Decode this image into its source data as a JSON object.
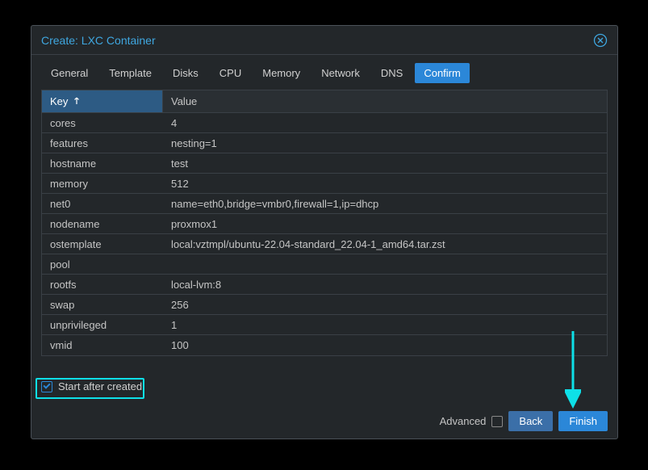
{
  "title": "Create: LXC Container",
  "tabs": {
    "general": "General",
    "template": "Template",
    "disks": "Disks",
    "cpu": "CPU",
    "memory": "Memory",
    "network": "Network",
    "dns": "DNS",
    "confirm": "Confirm"
  },
  "grid": {
    "key_header": "Key",
    "value_header": "Value"
  },
  "rows": [
    {
      "key": "cores",
      "value": "4"
    },
    {
      "key": "features",
      "value": "nesting=1"
    },
    {
      "key": "hostname",
      "value": "test"
    },
    {
      "key": "memory",
      "value": "512"
    },
    {
      "key": "net0",
      "value": "name=eth0,bridge=vmbr0,firewall=1,ip=dhcp"
    },
    {
      "key": "nodename",
      "value": "proxmox1"
    },
    {
      "key": "ostemplate",
      "value": "local:vztmpl/ubuntu-22.04-standard_22.04-1_amd64.tar.zst"
    },
    {
      "key": "pool",
      "value": ""
    },
    {
      "key": "rootfs",
      "value": "local-lvm:8"
    },
    {
      "key": "swap",
      "value": "256"
    },
    {
      "key": "unprivileged",
      "value": "1"
    },
    {
      "key": "vmid",
      "value": "100"
    }
  ],
  "start_after": "Start after created",
  "footer": {
    "advanced": "Advanced",
    "back": "Back",
    "finish": "Finish"
  }
}
